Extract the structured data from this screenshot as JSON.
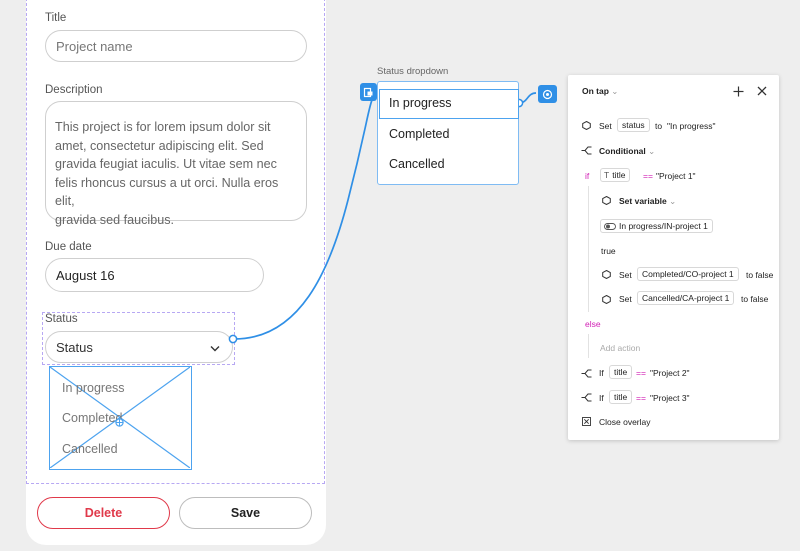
{
  "form": {
    "title_label": "Title",
    "title_placeholder": "Project name",
    "description_label": "Description",
    "description_text_lines": [
      "This project is for lorem ipsum dolor sit",
      "amet, consectetur adipiscing elit. Sed",
      "gravida feugiat iaculis. Ut vitae sem nec",
      "felis rhoncus cursus a ut orci. Nulla eros elit,",
      "gravida sed faucibus."
    ],
    "due_date_label": "Due date",
    "due_date_value": "August 16",
    "status_label": "Status",
    "status_value": "Status",
    "placeholder_options": [
      "In progress",
      "Completed",
      "Cancelled"
    ],
    "delete_label": "Delete",
    "save_label": "Save"
  },
  "status_dropdown": {
    "frame_name": "Status dropdown",
    "options": [
      "In progress",
      "Completed",
      "Cancelled"
    ]
  },
  "panel": {
    "header": "On tap",
    "set_word": "Set",
    "to_word": "to",
    "row1_variable": "status",
    "row1_value": "\"In progress\"",
    "conditional_label": "Conditional",
    "if_word": "if",
    "if_title": "title",
    "equals": "==",
    "project1": "\"Project 1\"",
    "set_variable_label": "Set variable",
    "toggle_variable": "In progress/IN-project 1",
    "true_text": "true",
    "set2_variable": "Completed/CO-project 1",
    "set2_value": "to false",
    "set3_variable": "Cancelled/CA-project 1",
    "set3_value": "to false",
    "else_word": "else",
    "add_action": "Add action",
    "if2_word": "If",
    "project2": "\"Project 2\"",
    "project3": "\"Project 3\"",
    "close_overlay": "Close overlay"
  },
  "colors": {
    "accent_blue": "#2f8fe6",
    "delete_red": "#e0394a",
    "magenta": "#d11fb5"
  }
}
